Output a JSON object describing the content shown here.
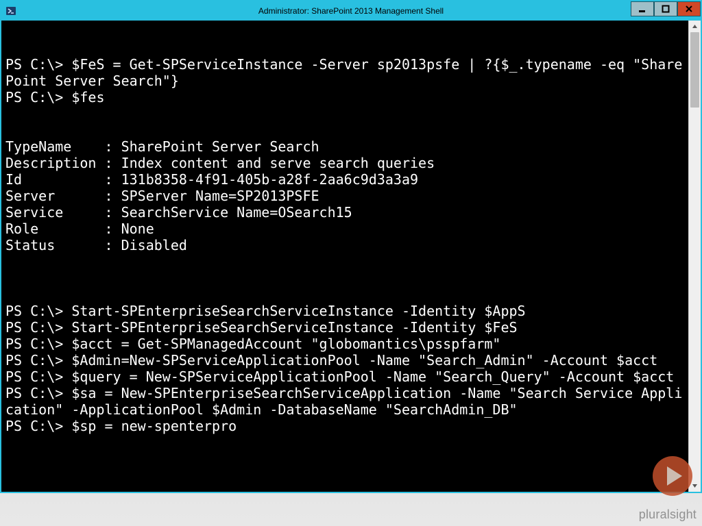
{
  "window": {
    "title": "Administrator: SharePoint 2013 Management Shell"
  },
  "console": {
    "lines": [
      "",
      "",
      "PS C:\\> $FeS = Get-SPServiceInstance -Server sp2013psfe | ?{$_.typename -eq \"SharePoint Server Search\"}",
      "PS C:\\> $fes",
      "",
      "",
      "TypeName    : SharePoint Server Search",
      "Description : Index content and serve search queries",
      "Id          : 131b8358-4f91-405b-a28f-2aa6c9d3a3a9",
      "Server      : SPServer Name=SP2013PSFE",
      "Service     : SearchService Name=OSearch15",
      "Role        : None",
      "Status      : Disabled",
      "",
      "",
      "",
      "PS C:\\> Start-SPEnterpriseSearchServiceInstance -Identity $AppS",
      "PS C:\\> Start-SPEnterpriseSearchServiceInstance -Identity $FeS",
      "PS C:\\> $acct = Get-SPManagedAccount \"globomantics\\psspfarm\"",
      "PS C:\\> $Admin=New-SPServiceApplicationPool -Name \"Search_Admin\" -Account $acct",
      "PS C:\\> $query = New-SPServiceApplicationPool -Name \"Search_Query\" -Account $acct",
      "PS C:\\> $sa = New-SPEnterpriseSearchServiceApplication -Name \"Search Service Application\" -ApplicationPool $Admin -DatabaseName \"SearchAdmin_DB\"",
      "PS C:\\> $sp = new-spenterpro"
    ]
  },
  "branding": {
    "text": "pluralsight"
  }
}
